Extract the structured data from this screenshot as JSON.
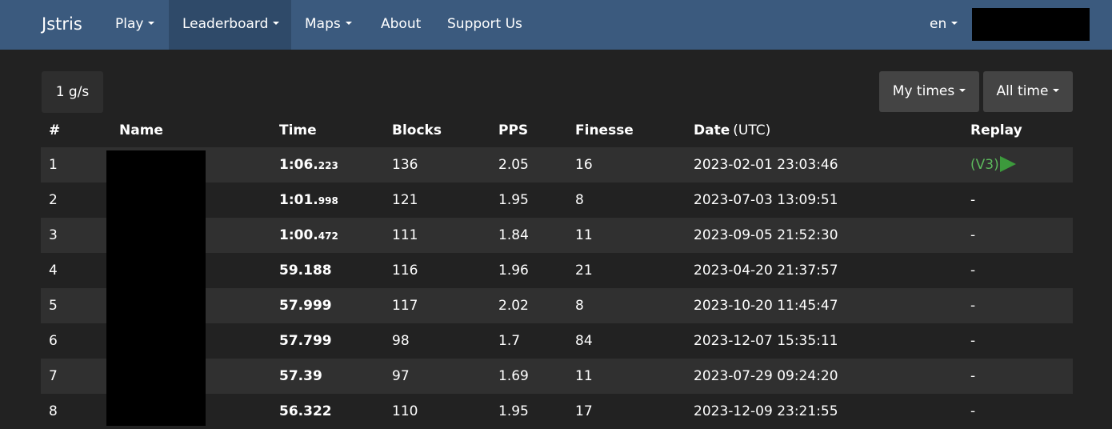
{
  "navbar": {
    "brand": "Jstris",
    "items": [
      {
        "label": "Play",
        "dropdown": true
      },
      {
        "label": "Leaderboard",
        "dropdown": true,
        "active": true
      },
      {
        "label": "Maps",
        "dropdown": true
      },
      {
        "label": "About",
        "dropdown": false
      },
      {
        "label": "Support Us",
        "dropdown": false
      }
    ],
    "language": "en"
  },
  "filters": {
    "mode": "1 g/s",
    "scope": "My times",
    "period": "All time"
  },
  "table": {
    "headers": {
      "rank": "#",
      "name": "Name",
      "time": "Time",
      "blocks": "Blocks",
      "pps": "PPS",
      "finesse": "Finesse",
      "date": "Date",
      "date_unit": "(UTC)",
      "replay": "Replay"
    },
    "rows": [
      {
        "rank": "1",
        "time_main": "1:06.",
        "time_ms": "223",
        "blocks": "136",
        "pps": "2.05",
        "finesse": "16",
        "date": "2023-02-01 23:03:46",
        "replay": "(V3)"
      },
      {
        "rank": "2",
        "time_main": "1:01.",
        "time_ms": "998",
        "blocks": "121",
        "pps": "1.95",
        "finesse": "8",
        "date": "2023-07-03 13:09:51",
        "replay": "-"
      },
      {
        "rank": "3",
        "time_main": "1:00.",
        "time_ms": "472",
        "blocks": "111",
        "pps": "1.84",
        "finesse": "11",
        "date": "2023-09-05 21:52:30",
        "replay": "-"
      },
      {
        "rank": "4",
        "time_main": "59.188",
        "time_ms": "",
        "blocks": "116",
        "pps": "1.96",
        "finesse": "21",
        "date": "2023-04-20 21:37:57",
        "replay": "-"
      },
      {
        "rank": "5",
        "time_main": "57.999",
        "time_ms": "",
        "blocks": "117",
        "pps": "2.02",
        "finesse": "8",
        "date": "2023-10-20 11:45:47",
        "replay": "-"
      },
      {
        "rank": "6",
        "time_main": "57.799",
        "time_ms": "",
        "blocks": "98",
        "pps": "1.7",
        "finesse": "84",
        "date": "2023-12-07 15:35:11",
        "replay": "-"
      },
      {
        "rank": "7",
        "time_main": "57.39",
        "time_ms": "",
        "blocks": "97",
        "pps": "1.69",
        "finesse": "11",
        "date": "2023-07-29 09:24:20",
        "replay": "-"
      },
      {
        "rank": "8",
        "time_main": "56.322",
        "time_ms": "",
        "blocks": "110",
        "pps": "1.95",
        "finesse": "17",
        "date": "2023-12-09 23:21:55",
        "replay": "-"
      }
    ]
  },
  "colors": {
    "navbar": "#3b5a7e",
    "background": "#222222",
    "row_alt": "#303030",
    "replay_accent": "#5cb85c"
  }
}
